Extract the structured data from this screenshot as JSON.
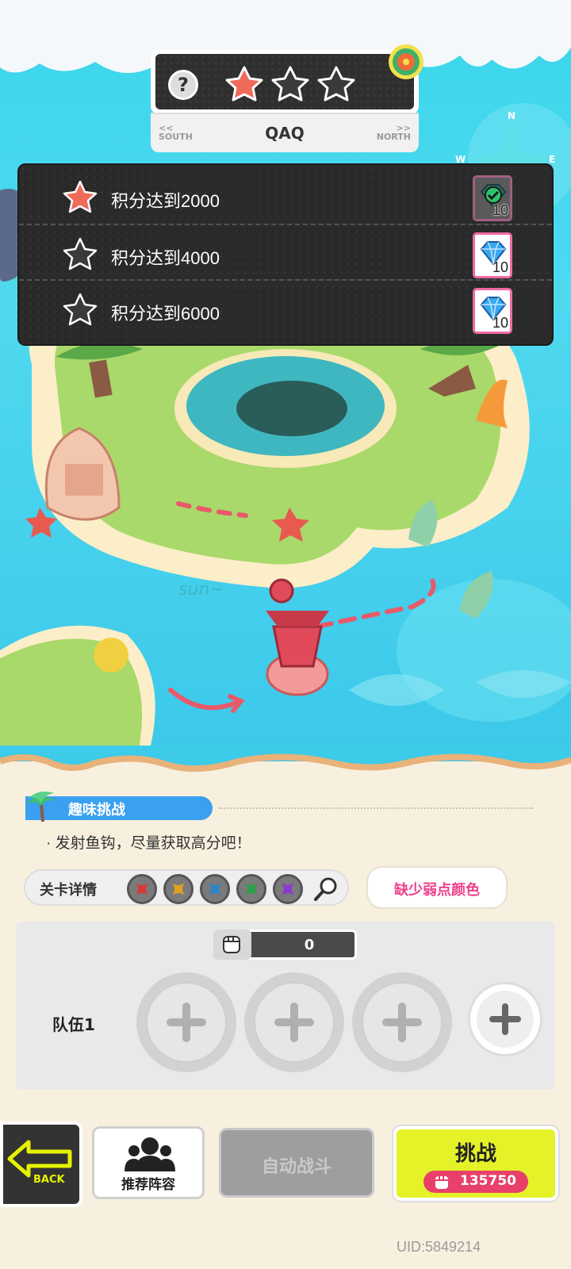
{
  "stage": {
    "help_icon": "question-mark",
    "stars_earned": 1,
    "stars_total": 3,
    "nav_left": "SOUTH",
    "nav_right": "NORTH",
    "name": "QAQ"
  },
  "tasks": [
    {
      "label": "积分达到2000",
      "reward_count": "10",
      "reward_icon": "gem-claimed-icon",
      "achieved": true
    },
    {
      "label": "积分达到4000",
      "reward_count": "10",
      "reward_icon": "diamond-icon",
      "achieved": false
    },
    {
      "label": "积分达到6000",
      "reward_count": "10",
      "reward_icon": "diamond-icon",
      "achieved": false
    }
  ],
  "map": {
    "label": "sun~"
  },
  "mode": {
    "title": "趣味挑战",
    "description": "· 发射鱼钩，尽量获取高分吧！"
  },
  "details": {
    "label": "关卡详情",
    "weakness_colors": [
      "#d83a3a",
      "#e0a020",
      "#2a86c8",
      "#2aa04a",
      "#8a3ad0"
    ],
    "missing_text": "缺少弱点颜色"
  },
  "team": {
    "label": "队伍1",
    "power": "0",
    "slots": 3
  },
  "buttons": {
    "back": "BACK",
    "recommend": "推荐阵容",
    "auto": "自动战斗",
    "challenge": "挑战",
    "cost": "135750"
  },
  "uid": "UID:5849214",
  "colors": {
    "star_active": "#f06a5a",
    "star_inactive": "#3a3a3a",
    "challenge_bg": "#e4f227",
    "cost_bg": "#e8406a",
    "mode_tag": "#3aa0f0"
  }
}
